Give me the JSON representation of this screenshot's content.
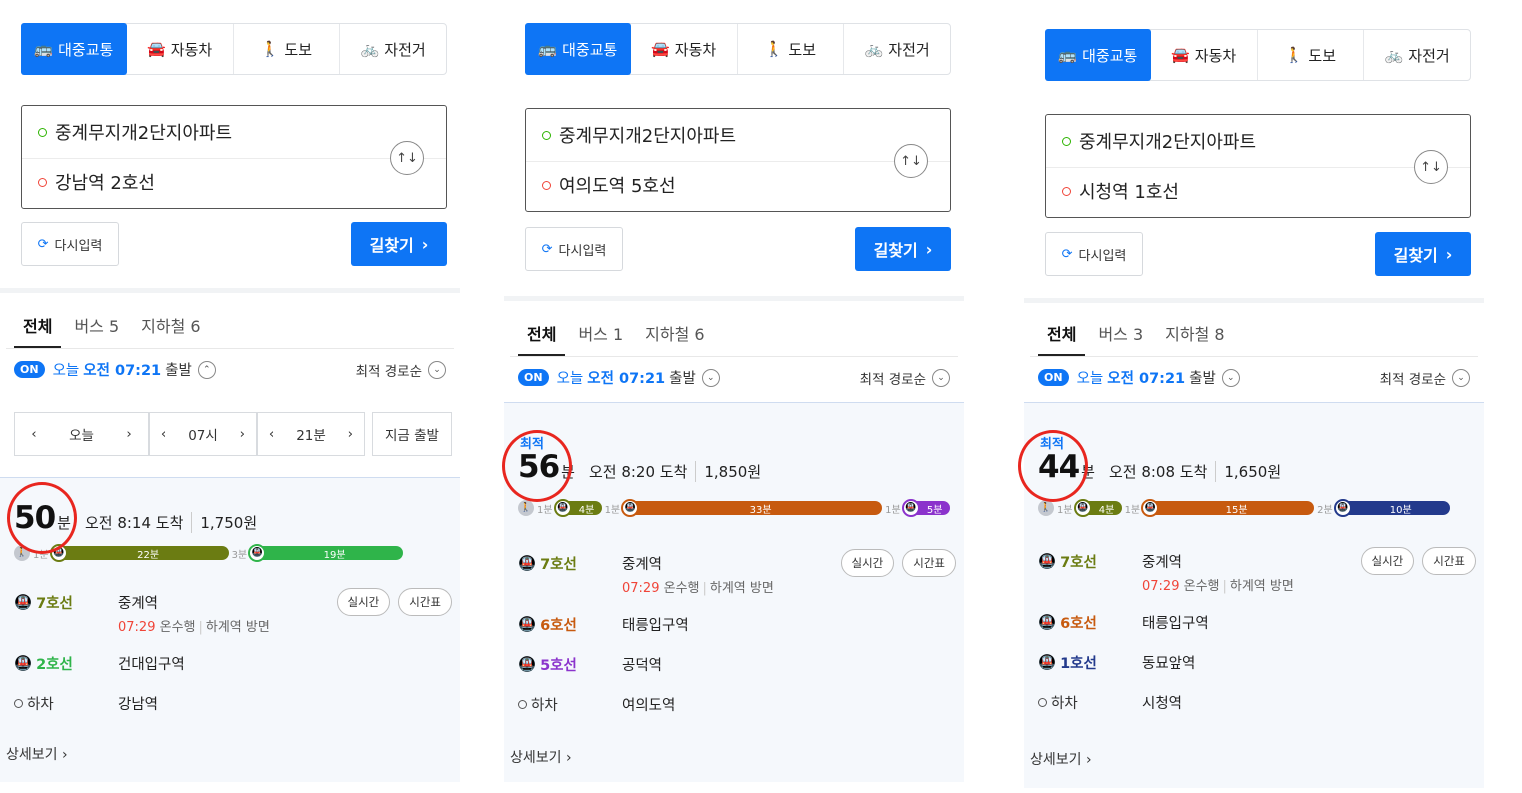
{
  "colors": {
    "accent": "#0e75f5",
    "line7": "#6b7c12",
    "line2": "#2fb44a",
    "line6": "#c75a0f",
    "line5": "#8b33cc",
    "line1": "#233a8c",
    "highlight": "#e8261f"
  },
  "common": {
    "modes": [
      {
        "label": "대중교통",
        "icon": "bus-icon"
      },
      {
        "label": "자동차",
        "icon": "car-icon"
      },
      {
        "label": "도보",
        "icon": "walk-icon"
      },
      {
        "label": "자전거",
        "icon": "bike-icon"
      }
    ],
    "origin": "중계무지개2단지아파트",
    "reset": "다시입력",
    "search": "길찾기",
    "tab_all": "전체",
    "on": "ON",
    "today": "오늘",
    "dep_time": "오전 07:21",
    "dep_suffix": "출발",
    "sort": "최적 경로순",
    "best": "최적",
    "unit": "분",
    "detail": "상세보기",
    "realtime": "실시간",
    "timetable": "시간표",
    "off": "하차",
    "picker": {
      "day": "오늘",
      "hour": "07시",
      "min": "21분",
      "now": "지금 출발"
    }
  },
  "panels": [
    {
      "dest": "강남역 2호선",
      "bus_tab": "버스 5",
      "sub_tab": "지하철 6",
      "duration": "50",
      "arrival": "오전 8:14 도착",
      "fare": "1,750원",
      "bar": [
        {
          "walk": "1분"
        },
        {
          "color": "#6b7c12",
          "mins": "22분"
        },
        {
          "gap": "3분"
        },
        {
          "color": "#2fb44a",
          "mins": "19분"
        }
      ],
      "legs": [
        {
          "line": "7호선",
          "station": "중계역",
          "color": "#6b7c12",
          "buttons": true,
          "sub_time": "07:29",
          "sub_dir": "온수행",
          "sub_plat": "하계역 방면"
        },
        {
          "line": "2호선",
          "station": "건대입구역",
          "color": "#2fb44a"
        }
      ],
      "off_station": "강남역"
    },
    {
      "dest": "여의도역 5호선",
      "bus_tab": "버스 1",
      "sub_tab": "지하철 6",
      "duration": "56",
      "arrival": "오전 8:20 도착",
      "fare": "1,850원",
      "bar": [
        {
          "walk": "1분"
        },
        {
          "color": "#6b7c12",
          "mins": "4분"
        },
        {
          "gap": "1분"
        },
        {
          "color": "#c75a0f",
          "mins": "33분"
        },
        {
          "gap": "1분"
        },
        {
          "color": "#8b33cc",
          "mins": "5분"
        }
      ],
      "legs": [
        {
          "line": "7호선",
          "station": "중계역",
          "color": "#6b7c12",
          "buttons": true,
          "sub_time": "07:29",
          "sub_dir": "온수행",
          "sub_plat": "하계역 방면"
        },
        {
          "line": "6호선",
          "station": "태릉입구역",
          "color": "#c75a0f"
        },
        {
          "line": "5호선",
          "station": "공덕역",
          "color": "#8b33cc"
        }
      ],
      "off_station": "여의도역"
    },
    {
      "dest": "시청역 1호선",
      "bus_tab": "버스 3",
      "sub_tab": "지하철 8",
      "duration": "44",
      "arrival": "오전 8:08 도착",
      "fare": "1,650원",
      "bar": [
        {
          "walk": "1분"
        },
        {
          "color": "#6b7c12",
          "mins": "4분"
        },
        {
          "gap": "1분"
        },
        {
          "color": "#c75a0f",
          "mins": "15분"
        },
        {
          "gap": "2분"
        },
        {
          "color": "#233a8c",
          "mins": "10분"
        }
      ],
      "legs": [
        {
          "line": "7호선",
          "station": "중계역",
          "color": "#6b7c12",
          "buttons": true,
          "sub_time": "07:29",
          "sub_dir": "온수행",
          "sub_plat": "하계역 방면"
        },
        {
          "line": "6호선",
          "station": "태릉입구역",
          "color": "#c75a0f"
        },
        {
          "line": "1호선",
          "station": "동묘앞역",
          "color": "#233a8c"
        }
      ],
      "off_station": "시청역"
    }
  ]
}
